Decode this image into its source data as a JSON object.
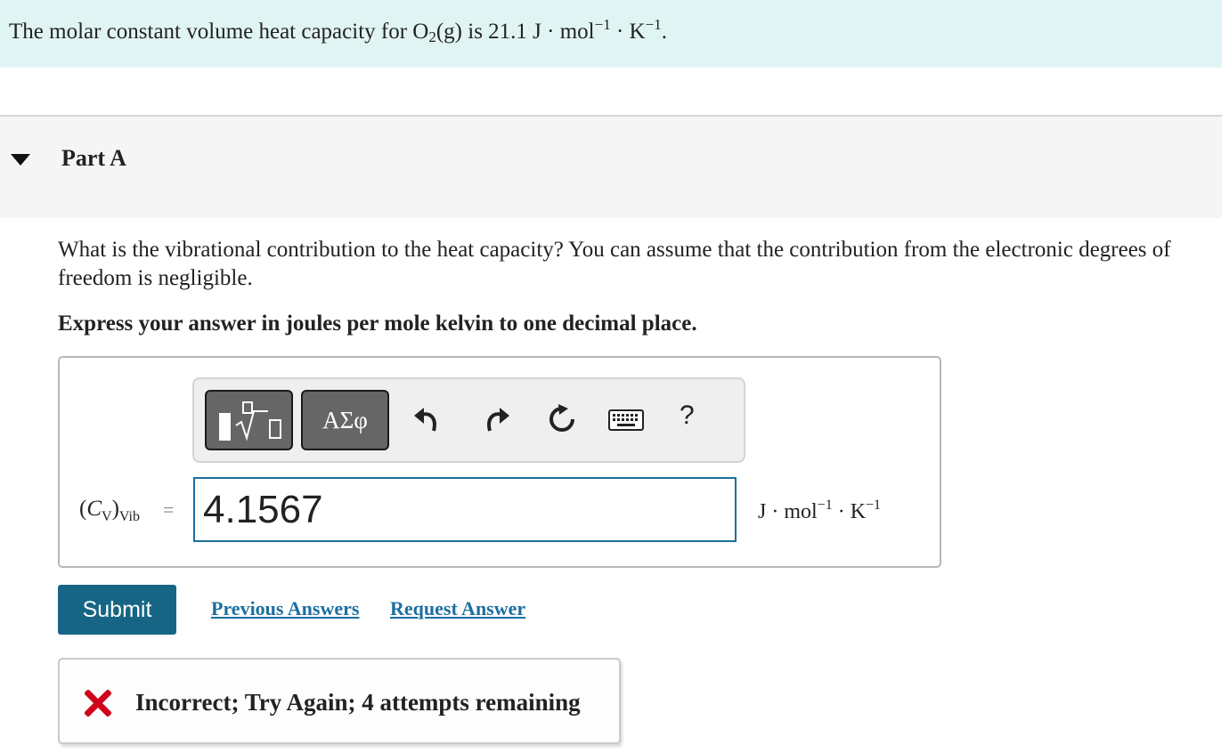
{
  "intro": {
    "text_before": "The molar constant volume heat capacity for O",
    "sub2": "2",
    "text_mid": "(g) is 21.1 J · mol",
    "sup1": "−1",
    "text_mid2": " · K",
    "sup2": "−1",
    "text_end": "."
  },
  "part": {
    "title": "Part A"
  },
  "question": {
    "text": "What is the vibrational contribution to the heat capacity? You can assume that the contribution from the electronic degrees of freedom is negligible.",
    "instruction": "Express your answer in joules per mole kelvin to one decimal place."
  },
  "toolbar": {
    "greek_label": "ΑΣφ",
    "help_label": "?"
  },
  "answer": {
    "var_main": "C",
    "var_sub_v": "V",
    "var_sub_vib": "Vib",
    "equals": "=",
    "value": "4.1567",
    "units_j": "J · mol",
    "units_sup1": "−1",
    "units_k": " · K",
    "units_sup2": "−1"
  },
  "actions": {
    "submit_label": "Submit",
    "previous_answers": "Previous Answers",
    "request_answer": "Request Answer"
  },
  "feedback": {
    "text": "Incorrect; Try Again; 4 attempts remaining",
    "status_color": "#d0021b"
  },
  "colors": {
    "intro_bg": "#e1f4f4",
    "accent": "#176585",
    "link": "#1c6fa0"
  }
}
